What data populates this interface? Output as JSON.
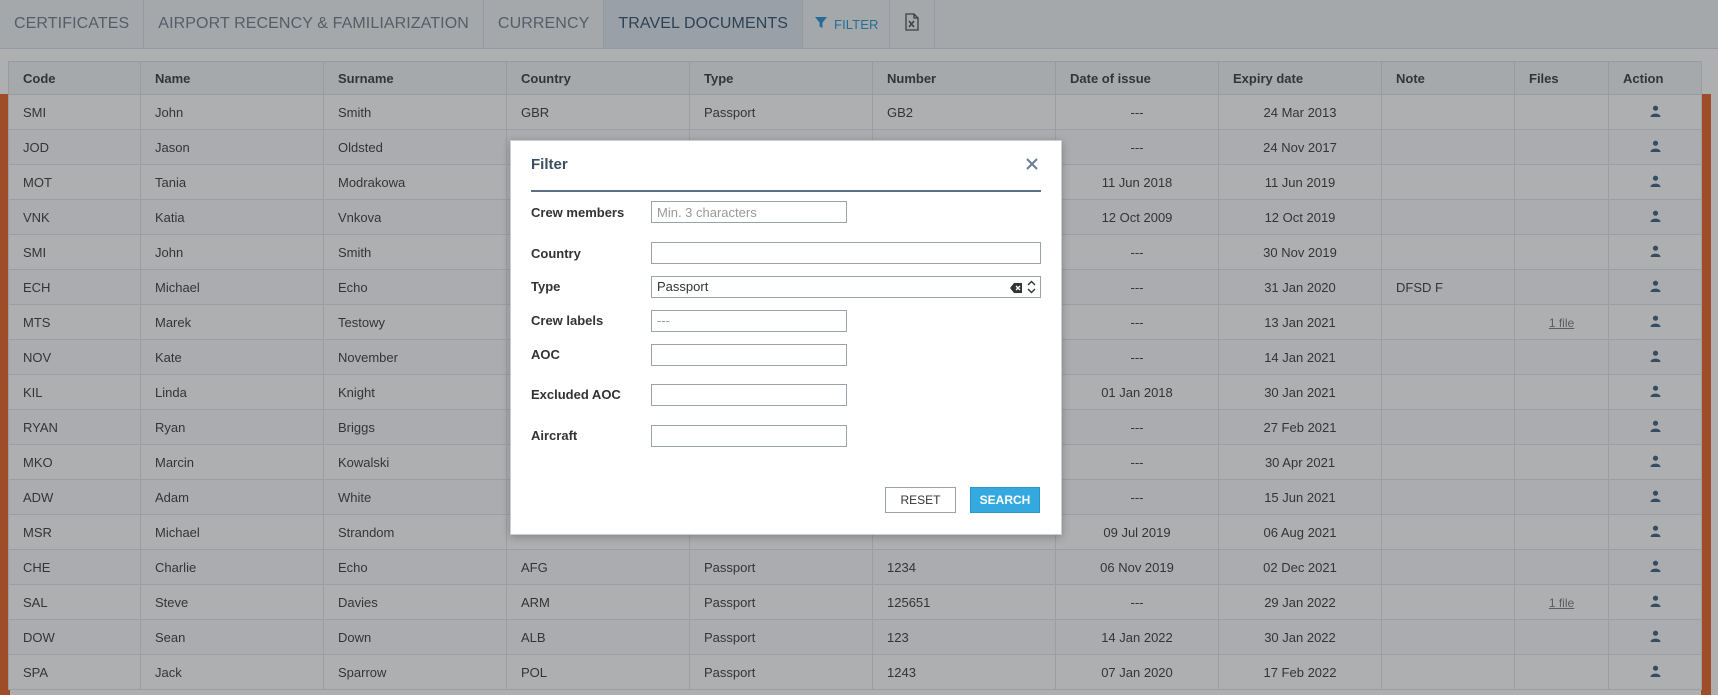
{
  "tabs": [
    {
      "label": "CERTIFICATES"
    },
    {
      "label": "AIRPORT RECENCY & FAMILIARIZATION"
    },
    {
      "label": "CURRENCY"
    },
    {
      "label": "TRAVEL DOCUMENTS"
    }
  ],
  "filter_tab": {
    "label": "FILTER"
  },
  "table": {
    "headers": [
      "Code",
      "Name",
      "Surname",
      "Country",
      "Type",
      "Number",
      "Date of issue",
      "Expiry date",
      "Note",
      "Files",
      "Action"
    ],
    "rows": [
      [
        "SMI",
        "John",
        "Smith",
        "GBR",
        "Passport",
        "GB2",
        "---",
        "24 Mar 2013",
        "",
        ""
      ],
      [
        "JOD",
        "Jason",
        "Oldsted",
        "",
        "",
        "",
        "---",
        "24 Nov 2017",
        "",
        ""
      ],
      [
        "MOT",
        "Tania",
        "Modrakowa",
        "",
        "",
        "",
        "11 Jun 2018",
        "11 Jun 2019",
        "",
        ""
      ],
      [
        "VNK",
        "Katia",
        "Vnkova",
        "",
        "",
        "",
        "12 Oct 2009",
        "12 Oct 2019",
        "",
        ""
      ],
      [
        "SMI",
        "John",
        "Smith",
        "",
        "",
        "",
        "---",
        "30 Nov 2019",
        "",
        ""
      ],
      [
        "ECH",
        "Michael",
        "Echo",
        "",
        "",
        "",
        "---",
        "31 Jan 2020",
        "DFSD F",
        ""
      ],
      [
        "MTS",
        "Marek",
        "Testowy",
        "",
        "",
        "",
        "---",
        "13 Jan 2021",
        "",
        "1 file"
      ],
      [
        "NOV",
        "Kate",
        "November",
        "",
        "",
        "",
        "---",
        "14 Jan 2021",
        "",
        ""
      ],
      [
        "KIL",
        "Linda",
        "Knight",
        "",
        "",
        "",
        "01 Jan 2018",
        "30 Jan 2021",
        "",
        ""
      ],
      [
        "RYAN",
        "Ryan",
        "Briggs",
        "",
        "",
        "",
        "---",
        "27 Feb 2021",
        "",
        ""
      ],
      [
        "MKO",
        "Marcin",
        "Kowalski",
        "",
        "",
        "",
        "---",
        "30 Apr 2021",
        "",
        ""
      ],
      [
        "ADW",
        "Adam",
        "White",
        "",
        "",
        "",
        "---",
        "15 Jun 2021",
        "",
        ""
      ],
      [
        "MSR",
        "Michael",
        "Strandom",
        "",
        "",
        "",
        "09 Jul 2019",
        "06 Aug 2021",
        "",
        ""
      ],
      [
        "CHE",
        "Charlie",
        "Echo",
        "AFG",
        "Passport",
        "1234",
        "06 Nov 2019",
        "02 Dec 2021",
        "",
        ""
      ],
      [
        "SAL",
        "Steve",
        "Davies",
        "ARM",
        "Passport",
        "125651",
        "---",
        "29 Jan 2022",
        "",
        "1 file"
      ],
      [
        "DOW",
        "Sean",
        "Down",
        "ALB",
        "Passport",
        "123",
        "14 Jan 2022",
        "30 Jan 2022",
        "",
        ""
      ],
      [
        "SPA",
        "Jack",
        "Sparrow",
        "POL",
        "Passport",
        "1243",
        "07 Jan 2020",
        "17 Feb 2022",
        "",
        ""
      ]
    ]
  },
  "dialog": {
    "title": "Filter",
    "crew_members": {
      "label": "Crew members",
      "placeholder": "Min. 3 characters"
    },
    "country": {
      "label": "Country",
      "value": ""
    },
    "type": {
      "label": "Type",
      "value": "Passport"
    },
    "crew_labels": {
      "label": "Crew labels",
      "value": "---"
    },
    "aoc": {
      "label": "AOC",
      "value": ""
    },
    "excluded_aoc": {
      "label": "Excluded AOC",
      "value": ""
    },
    "aircraft": {
      "label": "Aircraft",
      "value": ""
    },
    "reset_label": "RESET",
    "search_label": "SEARCH"
  },
  "colors": {
    "accent": "#33a9e0",
    "filter_tab": "#1e8fd6",
    "side_strip": "#e85a1b",
    "header_line": "#5b6f82"
  },
  "icons": [
    "filter-icon",
    "excel-export-icon",
    "person-icon",
    "close-icon",
    "clear-icon",
    "sort-arrows-icon"
  ]
}
